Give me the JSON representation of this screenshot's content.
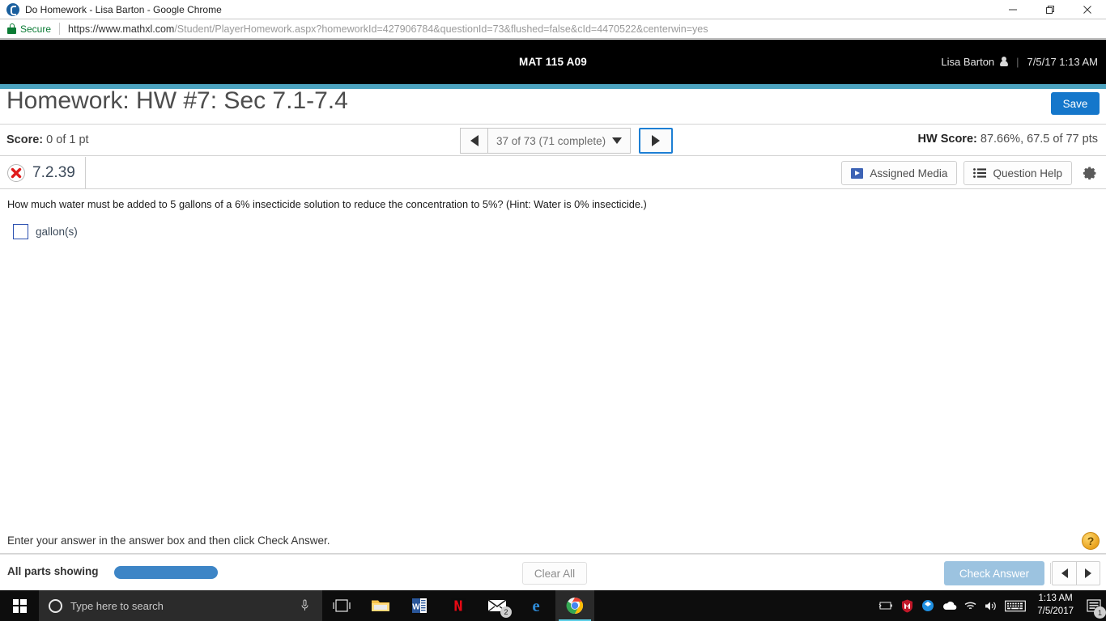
{
  "browser": {
    "title": "Do Homework - Lisa Barton - Google Chrome",
    "tab_icon": "pearson-icon",
    "security_label": "Secure",
    "url_host": "https://www.mathxl.com",
    "url_path": "/Student/PlayerHomework.aspx?homeworkId=427906784&questionId=73&flushed=false&cId=4470522&centerwin=yes",
    "window_controls": {
      "minimize": "minimize-icon",
      "maximize": "restore-icon",
      "close": "close-icon"
    }
  },
  "app_header": {
    "course": "MAT 115 A09",
    "user_name": "Lisa Barton",
    "separator": "|",
    "datetime": "7/5/17 1:13 AM",
    "accent_color": "#4ca3bf"
  },
  "title_row": {
    "title": "Homework: HW #7: Sec 7.1-7.4",
    "save_label": "Save",
    "save_color": "#1577cb"
  },
  "score_row": {
    "score_label": "Score:",
    "score_value": "0 of 1 pt",
    "question_nav": {
      "prev": "previous-question",
      "position": "37 of 73 (71 complete)",
      "next": "next-question"
    },
    "hw_score_label": "HW Score:",
    "hw_score_value": "87.66%, 67.5 of 77 pts"
  },
  "exercise": {
    "status_icon": "incorrect-x-icon",
    "id": "7.2.39",
    "assigned_media_label": "Assigned Media",
    "question_help_label": "Question Help",
    "settings_icon": "gear-icon"
  },
  "question": {
    "text": "How much water must be added to 5 gallons of a 6% insecticide solution to reduce the concentration to 5%? (Hint: Water is 0% insecticide.)",
    "answer_value": "",
    "unit_label": "gallon(s)"
  },
  "footer": {
    "instruction": "Enter your answer in the answer box and then click Check Answer.",
    "help_icon": "question-mark-icon",
    "parts_label": "All parts showing",
    "progress_color": "#3d85c6",
    "clear_all_label": "Clear All",
    "check_answer_label": "Check Answer",
    "check_answer_color": "#9cc3e0",
    "prev_label": "previous",
    "next_label": "next"
  },
  "taskbar": {
    "start_icon": "windows-start-icon",
    "search_placeholder": "Type here to search",
    "mic_icon": "microphone-icon",
    "task_view_icon": "task-view-icon",
    "pinned": [
      {
        "name": "file-explorer-icon"
      },
      {
        "name": "word-icon",
        "letter": "W"
      },
      {
        "name": "netflix-icon",
        "letter": "N"
      },
      {
        "name": "mail-icon",
        "badge": "2"
      },
      {
        "name": "edge-icon",
        "letter": "e"
      },
      {
        "name": "chrome-icon",
        "active": true
      }
    ],
    "tray": [
      {
        "name": "battery-icon"
      },
      {
        "name": "mcafee-shield-icon"
      },
      {
        "name": "dropbox-icon"
      },
      {
        "name": "onedrive-icon"
      },
      {
        "name": "wifi-icon"
      },
      {
        "name": "volume-icon"
      },
      {
        "name": "keyboard-icon"
      }
    ],
    "clock_time": "1:13 AM",
    "clock_date": "7/5/2017",
    "action_center_badge": "1"
  }
}
